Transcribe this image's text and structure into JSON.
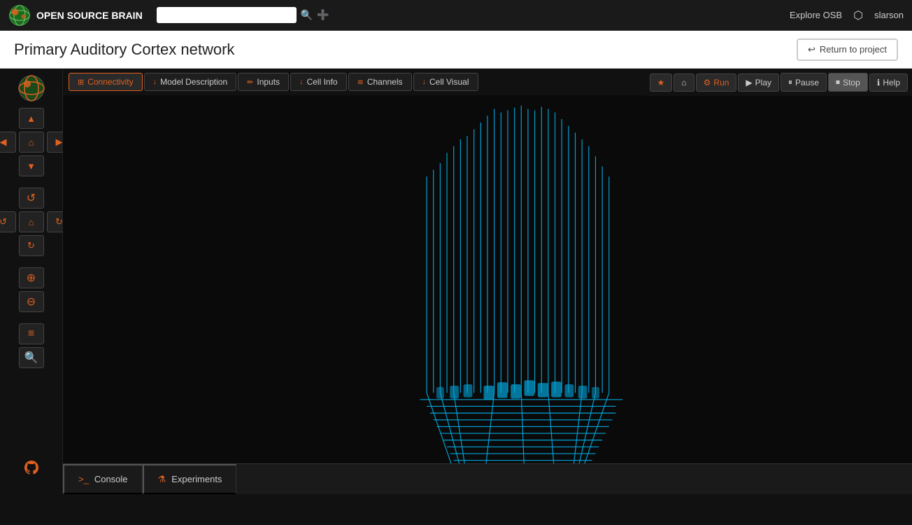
{
  "topnav": {
    "logo_text": "OPEN SOURCE BRAIN",
    "search_placeholder": "",
    "explore_label": "Explore OSB",
    "user_name": "slarson"
  },
  "title_bar": {
    "project_title": "Primary Auditory Cortex network",
    "return_label": "Return to project"
  },
  "tabs": [
    {
      "id": "connectivity",
      "label": "Connectivity",
      "icon": "⊞",
      "active": true
    },
    {
      "id": "model-description",
      "label": "Model Description",
      "icon": "↓",
      "active": false
    },
    {
      "id": "inputs",
      "label": "Inputs",
      "icon": "✏",
      "active": false
    },
    {
      "id": "cell-info",
      "label": "Cell Info",
      "icon": "↓",
      "active": false
    },
    {
      "id": "channels",
      "label": "Channels",
      "icon": "≋",
      "active": false
    },
    {
      "id": "cell-visual",
      "label": "Cell Visual",
      "icon": "↓",
      "active": false
    }
  ],
  "toolbar": {
    "star_label": "★",
    "home_label": "⌂",
    "run_label": "Run",
    "play_label": "Play",
    "pause_label": "Pause",
    "stop_label": "Stop",
    "help_label": "Help"
  },
  "sidebar": {
    "up_label": "▲",
    "left_label": "◀",
    "home_label": "⌂",
    "right_label": "▶",
    "down_label": "▼",
    "undo_label": "↺",
    "home2_label": "⌂",
    "redo_label": "↻",
    "reload_label": "↻",
    "zoom_in_label": "🔍+",
    "zoom_out_label": "🔍-",
    "list_label": "≡",
    "search_label": "🔍"
  },
  "bottom_tabs": [
    {
      "id": "console",
      "label": "Console",
      "icon": ">_"
    },
    {
      "id": "experiments",
      "label": "Experiments",
      "icon": "⚗"
    }
  ],
  "network": {
    "color": "#00bfff",
    "bg_color": "#0a0a0a"
  }
}
